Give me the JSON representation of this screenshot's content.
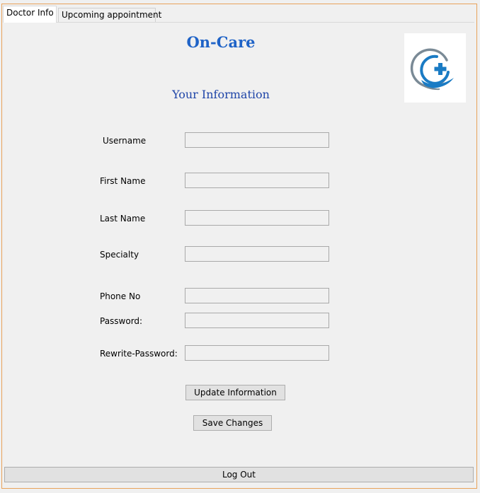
{
  "tabs": [
    {
      "label": "Doctor Info"
    },
    {
      "label": "Upcoming appointment"
    }
  ],
  "app_title": "On-Care",
  "section_title": "Your Information",
  "form": {
    "username_label": "Username",
    "username_value": "",
    "first_name_label": "First Name",
    "first_name_value": "",
    "last_name_label": "Last Name",
    "last_name_value": "",
    "specialty_label": "Specialty",
    "specialty_value": "",
    "phone_label": "Phone No",
    "phone_value": "",
    "password_label": "Password:",
    "password_value": "",
    "rewrite_password_label": "Rewrite-Password:",
    "rewrite_password_value": ""
  },
  "buttons": {
    "update": "Update Information",
    "save": "Save Changes",
    "logout": "Log Out"
  },
  "colors": {
    "title": "#1f63c7",
    "section_title": "#1f45a8",
    "logo_blue": "#1a7bc4",
    "logo_gray": "#7a8a96",
    "frame_border": "#e8a25a"
  }
}
